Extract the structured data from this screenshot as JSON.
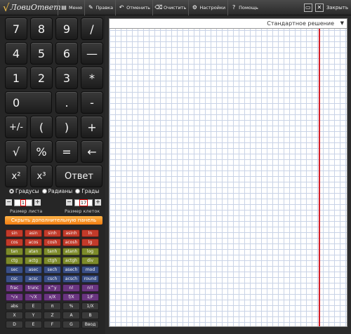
{
  "app": {
    "title": "ЛовиОтвет"
  },
  "toolbar": {
    "menu": "Меню",
    "edit": "Правка",
    "undo": "Отменить",
    "clear": "Очистить",
    "settings": "Настройки",
    "help": "Помощь",
    "close": "Закрыть"
  },
  "keypad": {
    "keys": [
      "7",
      "8",
      "9",
      "/",
      "4",
      "5",
      "6",
      "—",
      "1",
      "2",
      "3",
      "*",
      "0",
      ".",
      "-",
      "+/-",
      "(",
      ")",
      "+",
      "√",
      "%",
      "=",
      "←",
      "x²",
      "x³",
      "Ответ"
    ]
  },
  "angle_modes": {
    "degrees": "Градусы",
    "radians": "Радианы",
    "grads": "Грады",
    "selected": "degrees"
  },
  "sizes": {
    "sheet_label": "Размер листа",
    "sheet_value": "1",
    "cell_label": "Размер клеток",
    "cell_value": "17"
  },
  "hide_panel": "Скрыть дополнительную панель",
  "functions": [
    [
      "sin",
      "asin",
      "sinh",
      "asinh",
      "ln"
    ],
    [
      "cos",
      "acos",
      "cosh",
      "acosh",
      "lg"
    ],
    [
      "tan",
      "atan",
      "tanh",
      "atanh",
      "log"
    ],
    [
      "ctg",
      "actg",
      "ctgh",
      "actgh",
      "div"
    ],
    [
      "sec",
      "asec",
      "sech",
      "asech",
      "mod"
    ],
    [
      "csc",
      "acsc",
      "csch",
      "acsch",
      "round"
    ],
    [
      "frac",
      "trunc",
      "x^y",
      "n!",
      "n!!"
    ],
    [
      "ⁿ√x",
      "ⁿ√X",
      "x/X",
      "f/X",
      "1/F"
    ],
    [
      "abs",
      "E",
      "π",
      "%",
      "1/X"
    ],
    [
      "X",
      "Y",
      "Z",
      "A",
      "B"
    ],
    [
      "D",
      "E",
      "F",
      "G",
      "Ввод"
    ]
  ],
  "dropdown": {
    "value": "Стандартное решение"
  },
  "colors": {
    "accent": "#f07d12",
    "margin_line": "#d2202a",
    "grid": "#c9d3e6"
  }
}
